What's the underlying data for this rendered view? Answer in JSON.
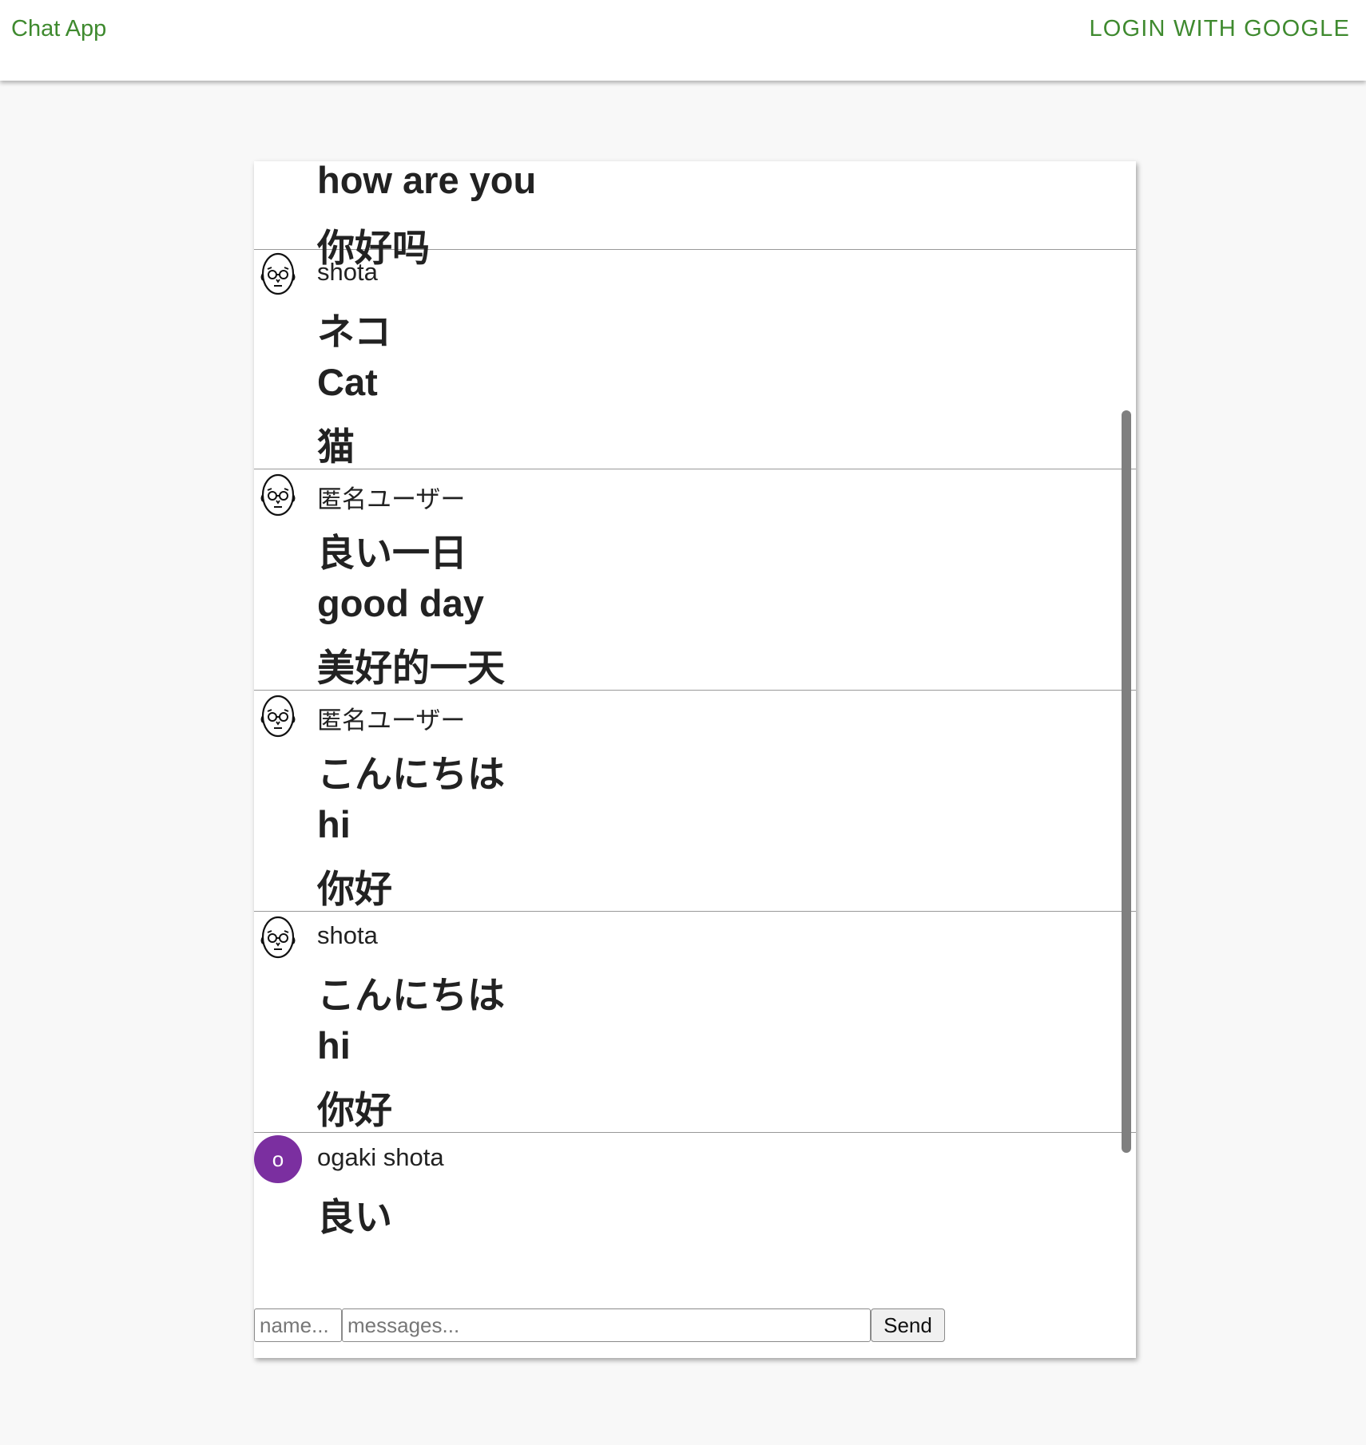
{
  "appbar": {
    "title": "Chat App",
    "login_label": "LOGIN WITH GOOGLE"
  },
  "messages": [
    {
      "user": "",
      "avatar": "face-icon",
      "lines": [
        "how are you",
        "你好吗"
      ]
    },
    {
      "user": "shota",
      "avatar": "face-icon",
      "lines": [
        "ネコ",
        "Cat",
        "猫"
      ]
    },
    {
      "user": "匿名ユーザー",
      "avatar": "face-icon",
      "lines": [
        "良い一日",
        "good day",
        "美好的一天"
      ]
    },
    {
      "user": "匿名ユーザー",
      "avatar": "face-icon",
      "lines": [
        "こんにちは",
        "hi",
        "你好"
      ]
    },
    {
      "user": "shota",
      "avatar": "face-icon",
      "lines": [
        "こんにちは",
        "hi",
        "你好"
      ]
    },
    {
      "user": "ogaki shota",
      "avatar": "letter-avatar",
      "avatar_letter": "o",
      "avatar_color": "#7b2fa0",
      "lines": [
        "良い"
      ]
    }
  ],
  "form": {
    "name_placeholder": "name...",
    "message_placeholder": "messages...",
    "send_label": "Send"
  },
  "colors": {
    "accent": "#3f8a2f",
    "avatar_purple": "#7b2fa0"
  }
}
